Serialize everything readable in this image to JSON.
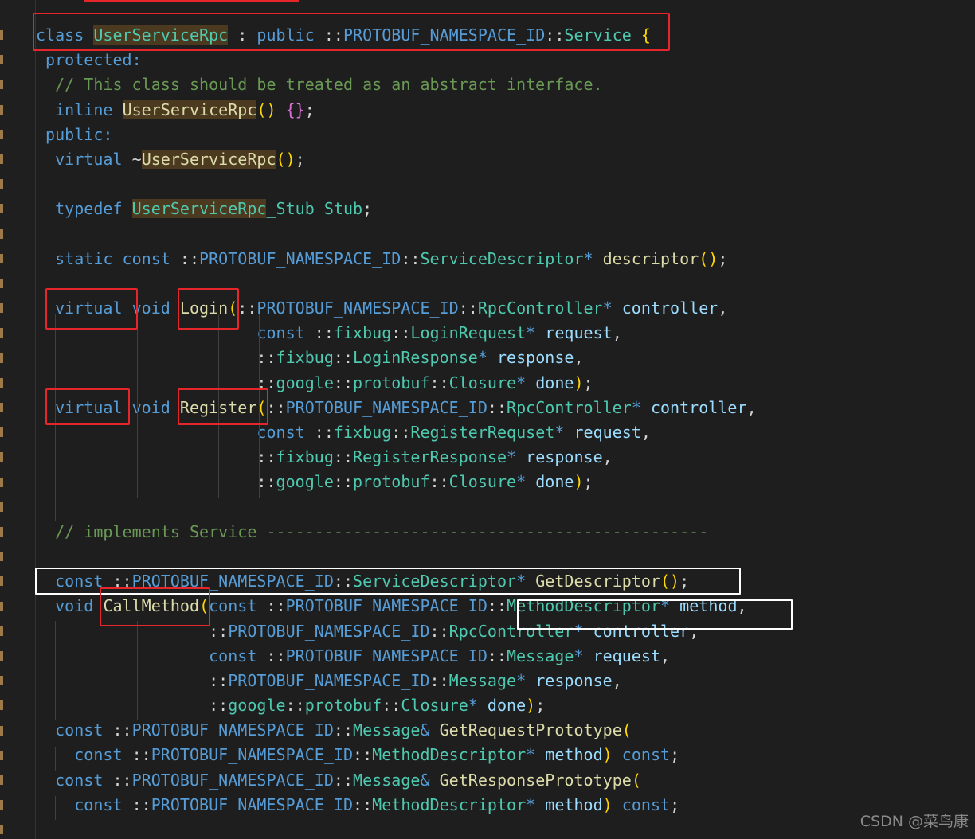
{
  "code_lines": [
    [
      {
        "t": "class ",
        "c": "kw"
      },
      {
        "t": "UserServiceRpc",
        "c": "ty hl"
      },
      {
        "t": " : ",
        "c": "pl"
      },
      {
        "t": "public ",
        "c": "kw"
      },
      {
        "t": "::",
        "c": "pl"
      },
      {
        "t": "PROTOBUF_NAMESPACE_ID",
        "c": "kw"
      },
      {
        "t": "::",
        "c": "pl"
      },
      {
        "t": "Service",
        "c": "ty"
      },
      {
        "t": " {",
        "c": "br1"
      }
    ],
    [
      {
        "t": " protected:",
        "c": "kw"
      }
    ],
    [
      {
        "t": "  // This class should be treated as an abstract interface.",
        "c": "cm"
      }
    ],
    [
      {
        "t": "  inline ",
        "c": "kw"
      },
      {
        "t": "UserServiceRpc",
        "c": "fn hl"
      },
      {
        "t": "()",
        "c": "br1"
      },
      {
        "t": " ",
        "c": "pl"
      },
      {
        "t": "{}",
        "c": "br2"
      },
      {
        "t": ";",
        "c": "pl"
      }
    ],
    [
      {
        "t": " public:",
        "c": "kw"
      }
    ],
    [
      {
        "t": "  virtual ",
        "c": "kw"
      },
      {
        "t": "~",
        "c": "pl"
      },
      {
        "t": "UserServiceRpc",
        "c": "fn hl"
      },
      {
        "t": "()",
        "c": "br1"
      },
      {
        "t": ";",
        "c": "pl"
      }
    ],
    [],
    [
      {
        "t": "  typedef ",
        "c": "kw"
      },
      {
        "t": "UserServiceRpc",
        "c": "ty hl"
      },
      {
        "t": "_Stub Stub",
        "c": "ty"
      },
      {
        "t": ";",
        "c": "pl"
      }
    ],
    [],
    [
      {
        "t": "  static const ",
        "c": "kw"
      },
      {
        "t": "::",
        "c": "pl"
      },
      {
        "t": "PROTOBUF_NAMESPACE_ID",
        "c": "kw"
      },
      {
        "t": "::",
        "c": "pl"
      },
      {
        "t": "ServiceDescriptor",
        "c": "ty"
      },
      {
        "t": "* ",
        "c": "kw"
      },
      {
        "t": "descriptor",
        "c": "fn"
      },
      {
        "t": "()",
        "c": "br1"
      },
      {
        "t": ";",
        "c": "pl"
      }
    ],
    [],
    [
      {
        "t": "  virtual void ",
        "c": "kw"
      },
      {
        "t": "Login",
        "c": "fn"
      },
      {
        "t": "(",
        "c": "br1"
      },
      {
        "t": "::",
        "c": "pl"
      },
      {
        "t": "PROTOBUF_NAMESPACE_ID",
        "c": "kw"
      },
      {
        "t": "::",
        "c": "pl"
      },
      {
        "t": "RpcController",
        "c": "ty"
      },
      {
        "t": "* ",
        "c": "kw"
      },
      {
        "t": "controller",
        "c": "var"
      },
      {
        "t": ",",
        "c": "pl"
      }
    ],
    [
      {
        "t": "                       const ",
        "c": "kw"
      },
      {
        "t": "::",
        "c": "pl"
      },
      {
        "t": "fixbug",
        "c": "ty"
      },
      {
        "t": "::",
        "c": "pl"
      },
      {
        "t": "LoginRequest",
        "c": "ty"
      },
      {
        "t": "* ",
        "c": "kw"
      },
      {
        "t": "request",
        "c": "var"
      },
      {
        "t": ",",
        "c": "pl"
      }
    ],
    [
      {
        "t": "                       ::",
        "c": "pl"
      },
      {
        "t": "fixbug",
        "c": "ty"
      },
      {
        "t": "::",
        "c": "pl"
      },
      {
        "t": "LoginResponse",
        "c": "ty"
      },
      {
        "t": "* ",
        "c": "kw"
      },
      {
        "t": "response",
        "c": "var"
      },
      {
        "t": ",",
        "c": "pl"
      }
    ],
    [
      {
        "t": "                       ::",
        "c": "pl"
      },
      {
        "t": "google",
        "c": "ty"
      },
      {
        "t": "::",
        "c": "pl"
      },
      {
        "t": "protobuf",
        "c": "ty"
      },
      {
        "t": "::",
        "c": "pl"
      },
      {
        "t": "Closure",
        "c": "ty"
      },
      {
        "t": "* ",
        "c": "kw"
      },
      {
        "t": "done",
        "c": "var"
      },
      {
        "t": ")",
        "c": "br1"
      },
      {
        "t": ";",
        "c": "pl"
      }
    ],
    [
      {
        "t": "  virtual void ",
        "c": "kw"
      },
      {
        "t": "Register",
        "c": "fn"
      },
      {
        "t": "(",
        "c": "br1"
      },
      {
        "t": "::",
        "c": "pl"
      },
      {
        "t": "PROTOBUF_NAMESPACE_ID",
        "c": "kw"
      },
      {
        "t": "::",
        "c": "pl"
      },
      {
        "t": "RpcController",
        "c": "ty"
      },
      {
        "t": "* ",
        "c": "kw"
      },
      {
        "t": "controller",
        "c": "var"
      },
      {
        "t": ",",
        "c": "pl"
      }
    ],
    [
      {
        "t": "                       const ",
        "c": "kw"
      },
      {
        "t": "::",
        "c": "pl"
      },
      {
        "t": "fixbug",
        "c": "ty"
      },
      {
        "t": "::",
        "c": "pl"
      },
      {
        "t": "RegisterRequset",
        "c": "ty"
      },
      {
        "t": "* ",
        "c": "kw"
      },
      {
        "t": "request",
        "c": "var"
      },
      {
        "t": ",",
        "c": "pl"
      }
    ],
    [
      {
        "t": "                       ::",
        "c": "pl"
      },
      {
        "t": "fixbug",
        "c": "ty"
      },
      {
        "t": "::",
        "c": "pl"
      },
      {
        "t": "RegisterResponse",
        "c": "ty"
      },
      {
        "t": "* ",
        "c": "kw"
      },
      {
        "t": "response",
        "c": "var"
      },
      {
        "t": ",",
        "c": "pl"
      }
    ],
    [
      {
        "t": "                       ::",
        "c": "pl"
      },
      {
        "t": "google",
        "c": "ty"
      },
      {
        "t": "::",
        "c": "pl"
      },
      {
        "t": "protobuf",
        "c": "ty"
      },
      {
        "t": "::",
        "c": "pl"
      },
      {
        "t": "Closure",
        "c": "ty"
      },
      {
        "t": "* ",
        "c": "kw"
      },
      {
        "t": "done",
        "c": "var"
      },
      {
        "t": ")",
        "c": "br1"
      },
      {
        "t": ";",
        "c": "pl"
      }
    ],
    [],
    [
      {
        "t": "  // implements Service ----------------------------------------------",
        "c": "cm"
      }
    ],
    [],
    [
      {
        "t": "  const ",
        "c": "kw"
      },
      {
        "t": "::",
        "c": "pl"
      },
      {
        "t": "PROTOBUF_NAMESPACE_ID",
        "c": "kw"
      },
      {
        "t": "::",
        "c": "pl"
      },
      {
        "t": "ServiceDescriptor",
        "c": "ty"
      },
      {
        "t": "* ",
        "c": "kw"
      },
      {
        "t": "GetDescriptor",
        "c": "fn"
      },
      {
        "t": "()",
        "c": "br1"
      },
      {
        "t": ";",
        "c": "pl"
      }
    ],
    [
      {
        "t": "  void ",
        "c": "kw"
      },
      {
        "t": "CallMethod",
        "c": "fn"
      },
      {
        "t": "(",
        "c": "br1"
      },
      {
        "t": "const ",
        "c": "kw"
      },
      {
        "t": "::",
        "c": "pl"
      },
      {
        "t": "PROTOBUF_NAMESPACE_ID",
        "c": "kw"
      },
      {
        "t": "::",
        "c": "pl"
      },
      {
        "t": "MethodDescriptor",
        "c": "ty"
      },
      {
        "t": "* ",
        "c": "kw"
      },
      {
        "t": "method",
        "c": "var"
      },
      {
        "t": ",",
        "c": "pl"
      }
    ],
    [
      {
        "t": "                  ::",
        "c": "pl"
      },
      {
        "t": "PROTOBUF_NAMESPACE_ID",
        "c": "kw"
      },
      {
        "t": "::",
        "c": "pl"
      },
      {
        "t": "RpcController",
        "c": "ty"
      },
      {
        "t": "* ",
        "c": "kw"
      },
      {
        "t": "controller",
        "c": "var"
      },
      {
        "t": ",",
        "c": "pl"
      }
    ],
    [
      {
        "t": "                  const ",
        "c": "kw"
      },
      {
        "t": "::",
        "c": "pl"
      },
      {
        "t": "PROTOBUF_NAMESPACE_ID",
        "c": "kw"
      },
      {
        "t": "::",
        "c": "pl"
      },
      {
        "t": "Message",
        "c": "ty"
      },
      {
        "t": "* ",
        "c": "kw"
      },
      {
        "t": "request",
        "c": "var"
      },
      {
        "t": ",",
        "c": "pl"
      }
    ],
    [
      {
        "t": "                  ::",
        "c": "pl"
      },
      {
        "t": "PROTOBUF_NAMESPACE_ID",
        "c": "kw"
      },
      {
        "t": "::",
        "c": "pl"
      },
      {
        "t": "Message",
        "c": "ty"
      },
      {
        "t": "* ",
        "c": "kw"
      },
      {
        "t": "response",
        "c": "var"
      },
      {
        "t": ",",
        "c": "pl"
      }
    ],
    [
      {
        "t": "                  ::",
        "c": "pl"
      },
      {
        "t": "google",
        "c": "ty"
      },
      {
        "t": "::",
        "c": "pl"
      },
      {
        "t": "protobuf",
        "c": "ty"
      },
      {
        "t": "::",
        "c": "pl"
      },
      {
        "t": "Closure",
        "c": "ty"
      },
      {
        "t": "* ",
        "c": "kw"
      },
      {
        "t": "done",
        "c": "var"
      },
      {
        "t": ")",
        "c": "br1"
      },
      {
        "t": ";",
        "c": "pl"
      }
    ],
    [
      {
        "t": "  const ",
        "c": "kw"
      },
      {
        "t": "::",
        "c": "pl"
      },
      {
        "t": "PROTOBUF_NAMESPACE_ID",
        "c": "kw"
      },
      {
        "t": "::",
        "c": "pl"
      },
      {
        "t": "Message",
        "c": "ty"
      },
      {
        "t": "& ",
        "c": "kw"
      },
      {
        "t": "GetRequestPrototype",
        "c": "fn"
      },
      {
        "t": "(",
        "c": "br1"
      }
    ],
    [
      {
        "t": "    const ",
        "c": "kw"
      },
      {
        "t": "::",
        "c": "pl"
      },
      {
        "t": "PROTOBUF_NAMESPACE_ID",
        "c": "kw"
      },
      {
        "t": "::",
        "c": "pl"
      },
      {
        "t": "MethodDescriptor",
        "c": "ty"
      },
      {
        "t": "* ",
        "c": "kw"
      },
      {
        "t": "method",
        "c": "var"
      },
      {
        "t": ")",
        "c": "br1"
      },
      {
        "t": " const",
        "c": "kw"
      },
      {
        "t": ";",
        "c": "pl"
      }
    ],
    [
      {
        "t": "  const ",
        "c": "kw"
      },
      {
        "t": "::",
        "c": "pl"
      },
      {
        "t": "PROTOBUF_NAMESPACE_ID",
        "c": "kw"
      },
      {
        "t": "::",
        "c": "pl"
      },
      {
        "t": "Message",
        "c": "ty"
      },
      {
        "t": "& ",
        "c": "kw"
      },
      {
        "t": "GetResponsePrototype",
        "c": "fn"
      },
      {
        "t": "(",
        "c": "br1"
      }
    ],
    [
      {
        "t": "    const ",
        "c": "kw"
      },
      {
        "t": "::",
        "c": "pl"
      },
      {
        "t": "PROTOBUF_NAMESPACE_ID",
        "c": "kw"
      },
      {
        "t": "::",
        "c": "pl"
      },
      {
        "t": "MethodDescriptor",
        "c": "ty"
      },
      {
        "t": "* ",
        "c": "kw"
      },
      {
        "t": "method",
        "c": "var"
      },
      {
        "t": ")",
        "c": "br1"
      },
      {
        "t": " const",
        "c": "kw"
      },
      {
        "t": ";",
        "c": "pl"
      }
    ]
  ],
  "watermark": "CSDN @菜鸟康",
  "colors": {
    "keyword": "#569cd6",
    "type": "#4ec9b0",
    "function": "#dcdcaa",
    "variable": "#9cdcfe",
    "comment": "#6a9955",
    "bracket": "#ffd700",
    "highlight": "#4b3a1f",
    "annotation_red": "#e5262b",
    "annotation_white": "#ffffff"
  }
}
